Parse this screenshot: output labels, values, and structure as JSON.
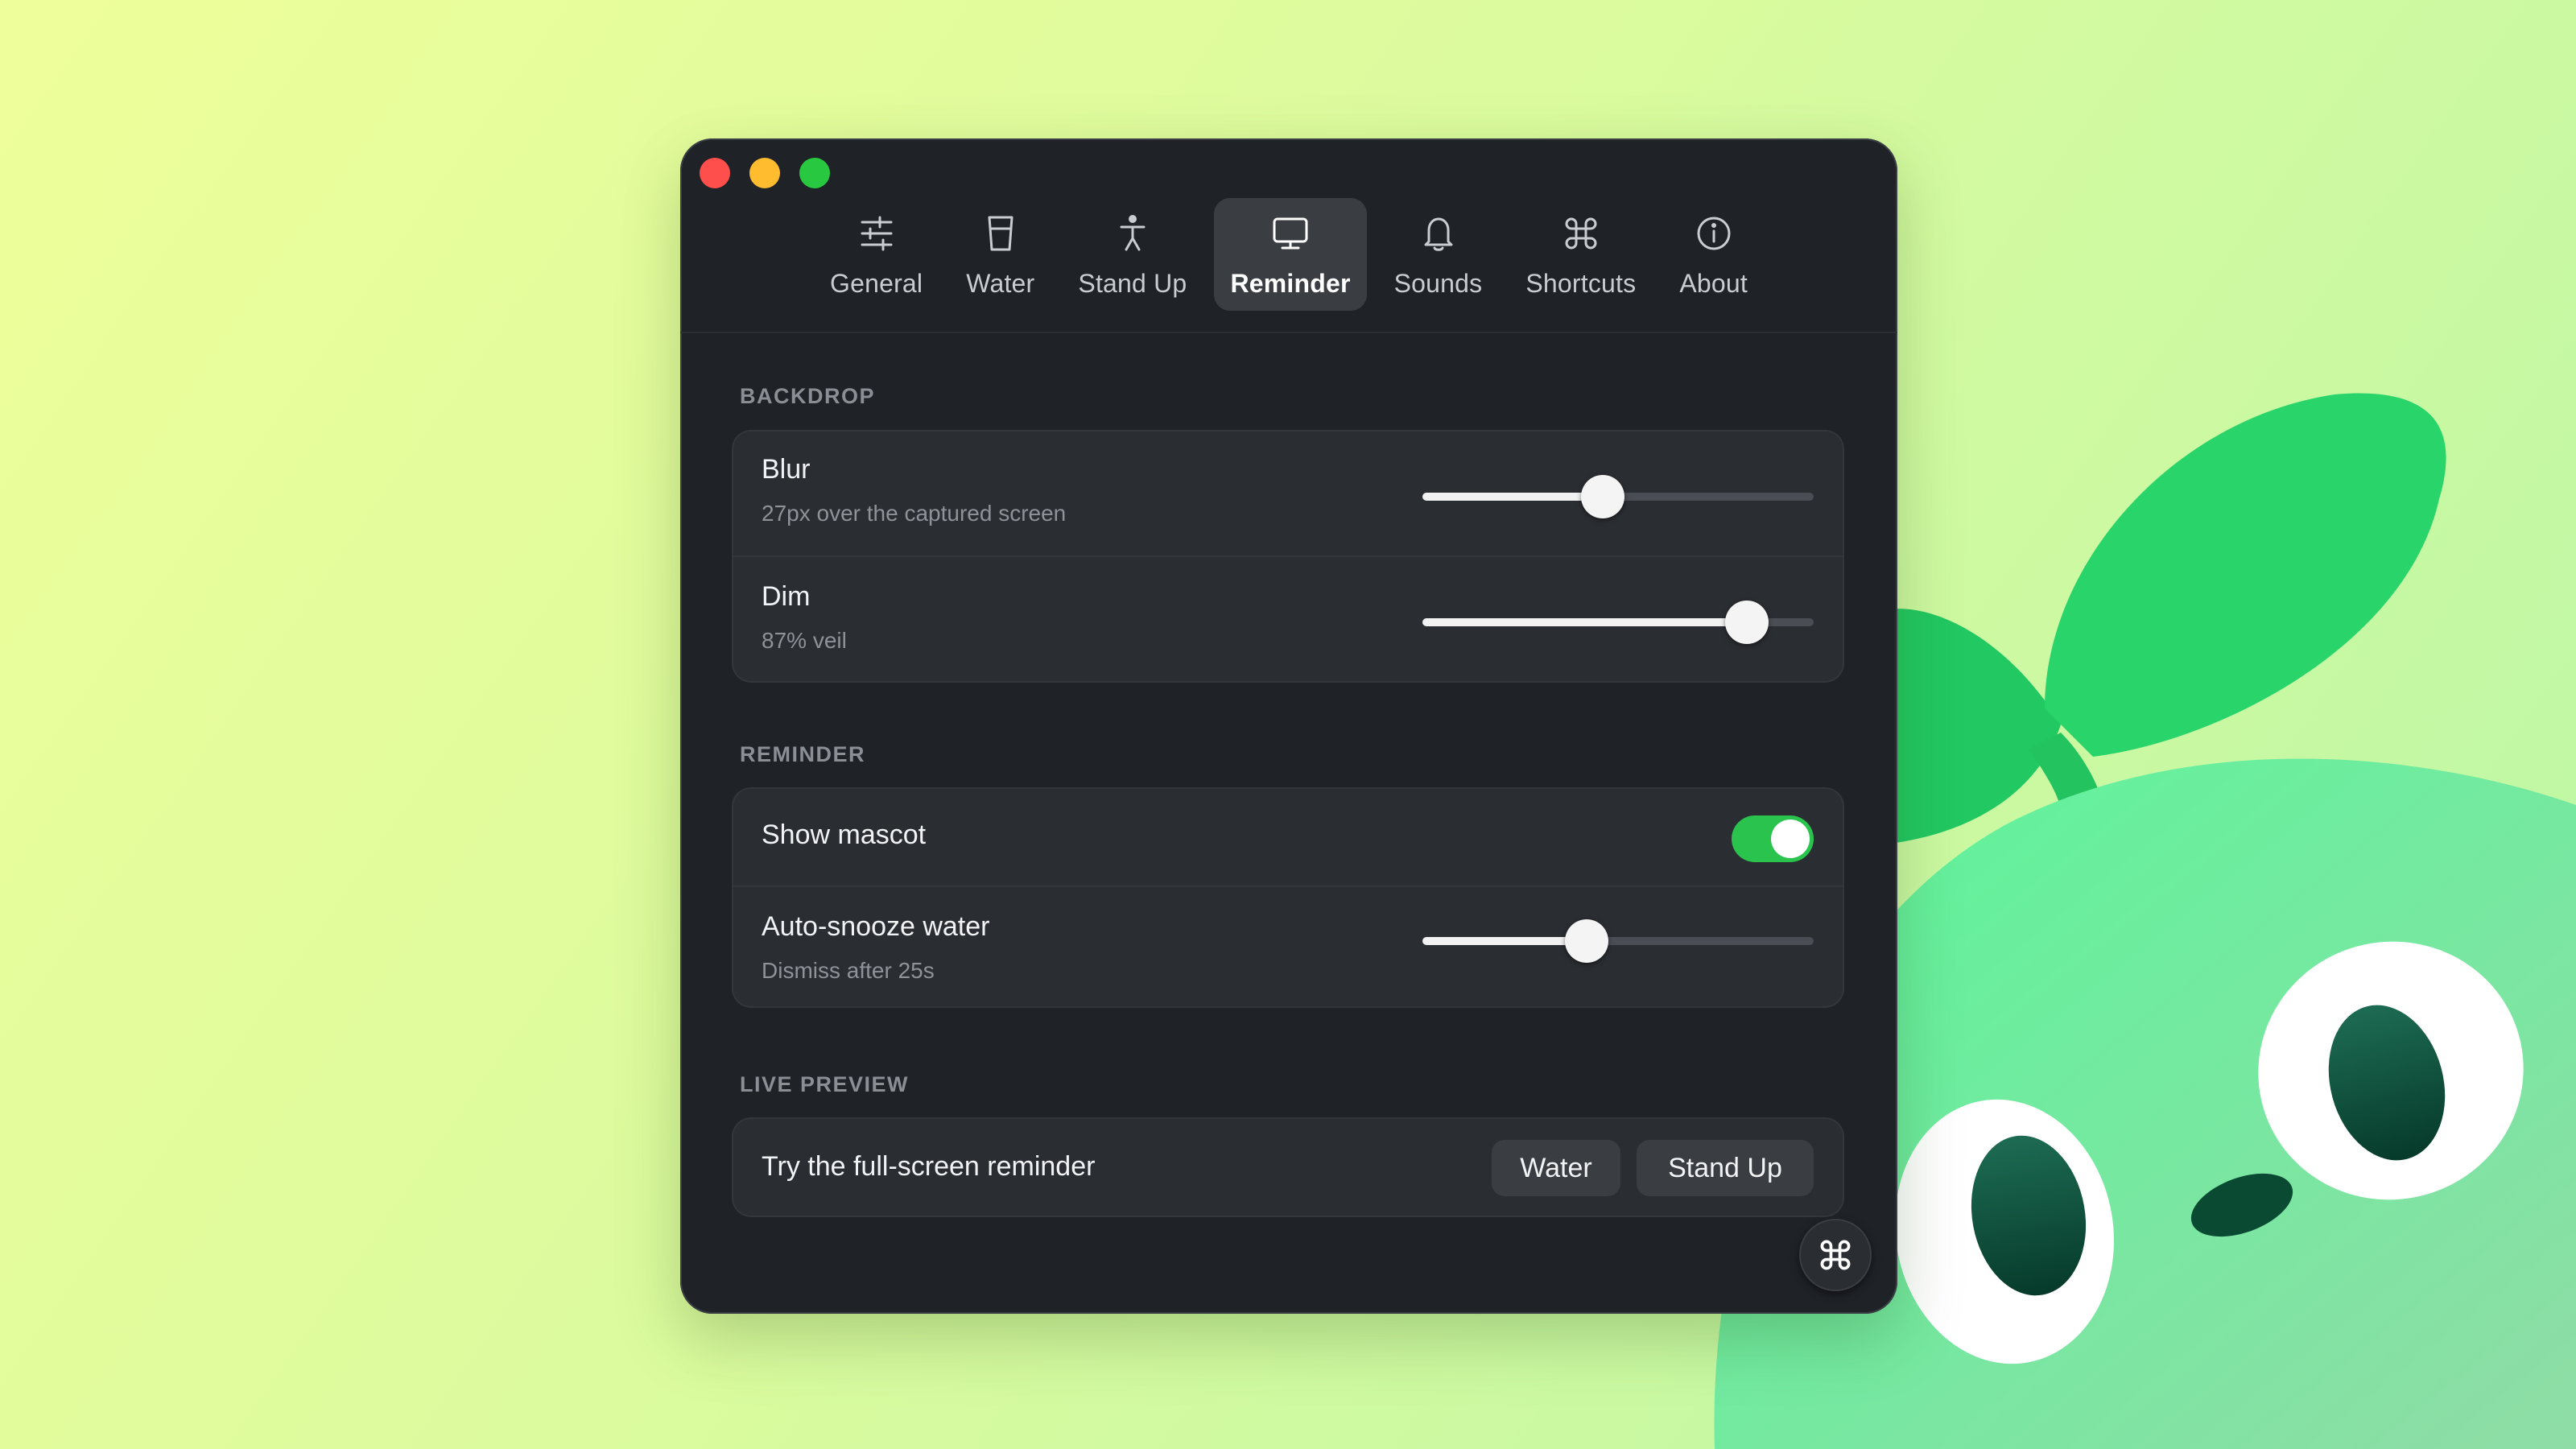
{
  "window": {
    "tabs": [
      {
        "label": "General",
        "icon": "sliders-icon"
      },
      {
        "label": "Water",
        "icon": "glass-icon"
      },
      {
        "label": "Stand Up",
        "icon": "figure-icon"
      },
      {
        "label": "Reminder",
        "icon": "monitor-icon",
        "active": true
      },
      {
        "label": "Sounds",
        "icon": "bell-icon"
      },
      {
        "label": "Shortcuts",
        "icon": "command-icon"
      },
      {
        "label": "About",
        "icon": "info-icon"
      }
    ]
  },
  "backdrop": {
    "title": "BACKDROP",
    "blur": {
      "label": "Blur",
      "sub": "27px over the captured screen",
      "level": 0.46
    },
    "dim": {
      "label": "Dim",
      "sub": "87% veil",
      "level": 0.83
    }
  },
  "reminder": {
    "title": "REMINDER",
    "show_mascot": {
      "label": "Show mascot",
      "on": true
    },
    "auto_snooze": {
      "label": "Auto-snooze water",
      "sub": "Dismiss after 25s",
      "level": 0.42
    }
  },
  "live_preview": {
    "title": "LIVE PREVIEW",
    "label": "Try the full-screen reminder",
    "water_button": "Water",
    "standup_button": "Stand Up"
  },
  "colors": {
    "accent_green": "#2ac34e",
    "window_bg": "#1f2227",
    "card_bg": "#2a2d32",
    "mascot_green": "#5ef29a"
  },
  "fab_icon": "command-icon"
}
